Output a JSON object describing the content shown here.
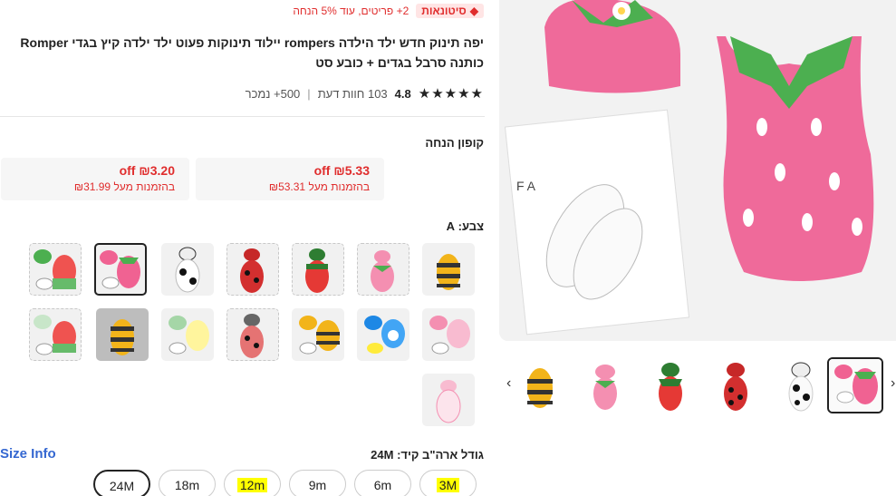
{
  "bulk": {
    "badge": "סיטונאות",
    "text": "2+ פריטים, עוד 5% הנחה"
  },
  "product": {
    "title": "יפה תינוק חדש ילד הילדה rompers יילוד תינוקות פעוט ילד ילדה קיץ בגדי Romper כותנה סרבל בגדים + כובע סט",
    "rating": "4.8",
    "stars": "★★★★★",
    "reviews": "103 חוות דעת",
    "sold": "500+ נמכר"
  },
  "coupon": {
    "title": "קופון הנחה",
    "items": [
      {
        "amount": "₪5.33 off",
        "condition": "בהזמנות מעל ₪53.31"
      },
      {
        "amount": "₪3.20 off",
        "condition": "בהזמנות מעל ₪31.99"
      }
    ]
  },
  "color": {
    "label": "צבע: A"
  },
  "size": {
    "label": "גודל ארה\"ב קיד: 24M",
    "info": "Size Info",
    "options": [
      "3M",
      "6m",
      "9m",
      "12m",
      "18m",
      "24M"
    ]
  },
  "gallery": {
    "prev_icon": "‹",
    "next_icon": "›"
  }
}
